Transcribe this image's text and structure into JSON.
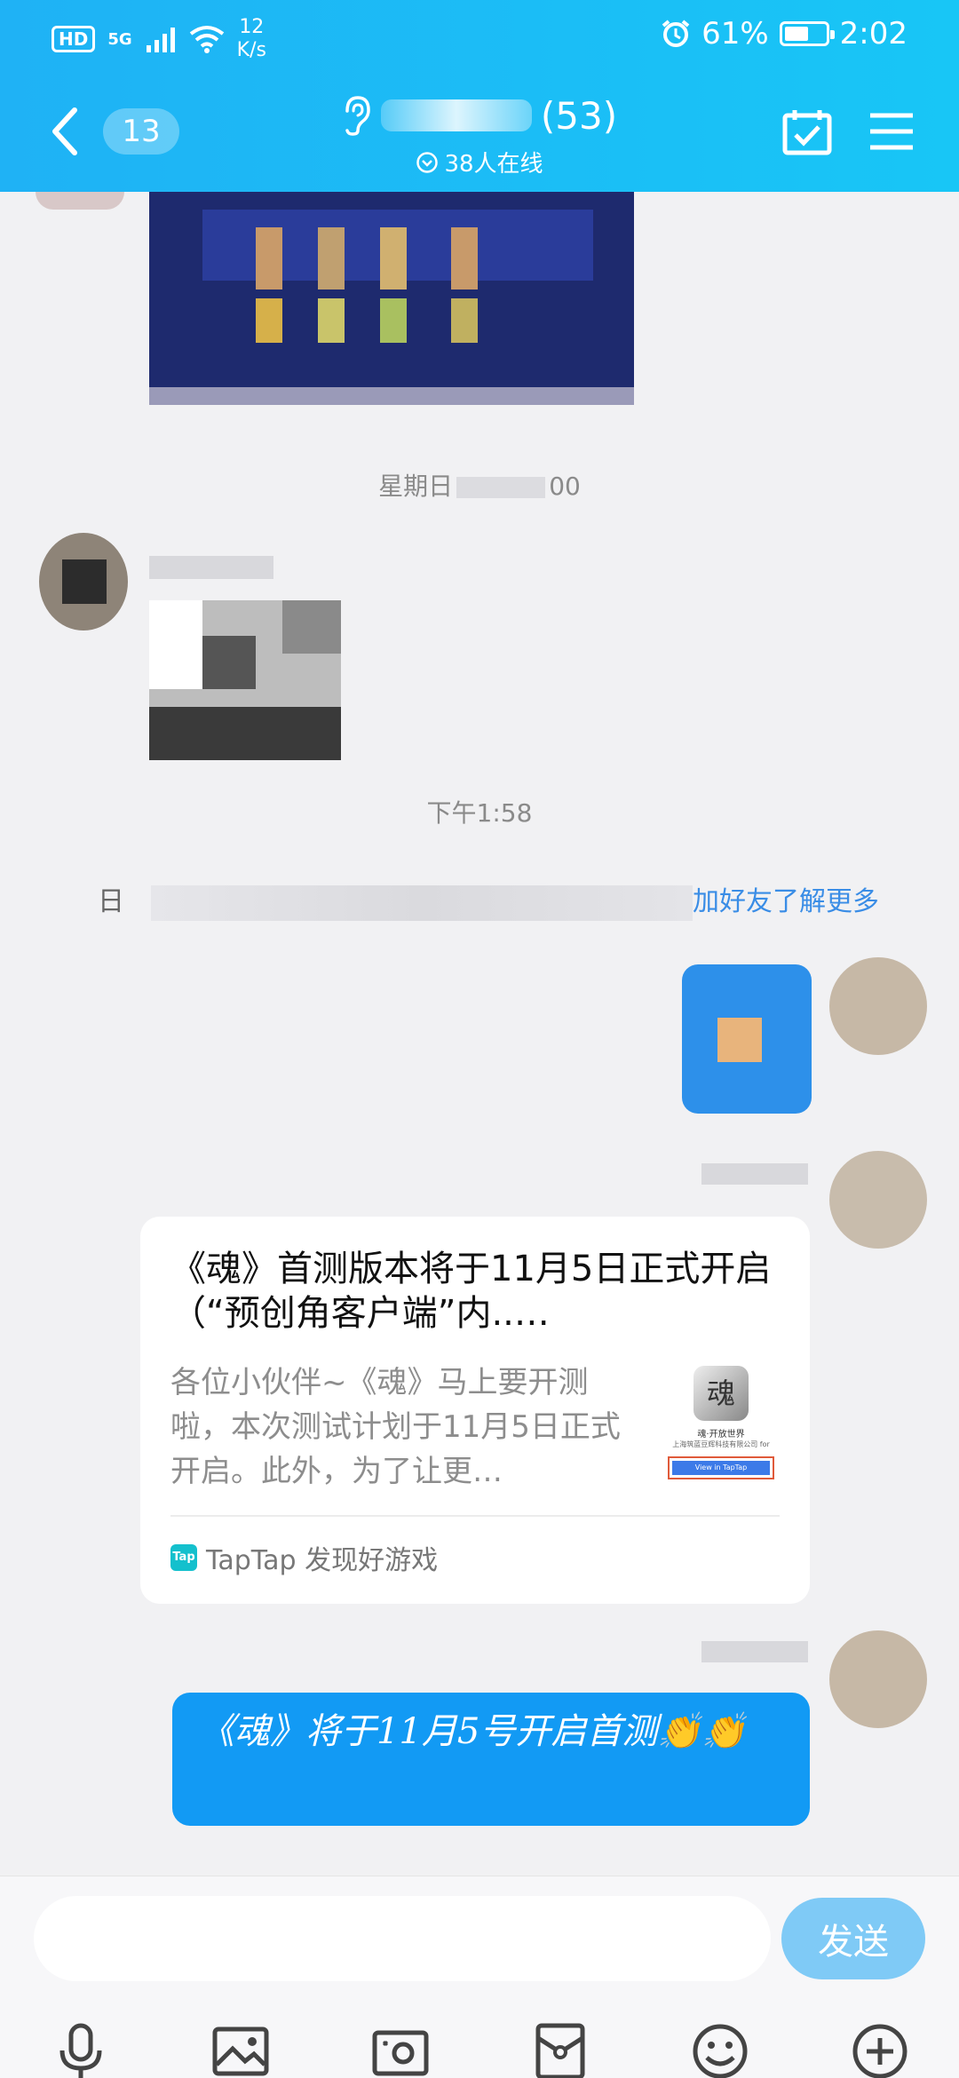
{
  "status_bar": {
    "hd": "HD",
    "network": "5G",
    "speed_value": "12",
    "speed_unit": "K/s",
    "battery": "61%",
    "battery_level": 0.61,
    "time": "2:02"
  },
  "header": {
    "unread_count": "13",
    "group_count": "(53)",
    "online": "38人在线"
  },
  "chat": {
    "time_1": "星期日",
    "time_1_tail": "00",
    "time_2": "下午1:58",
    "system_message": {
      "prefix": "日",
      "link": "加好友了解更多"
    },
    "link_card": {
      "title": "《魂》首测版本将于11月5日正式开启（“预创角客户端”内..…",
      "description": "各位小伙伴~《魂》马上要开测啦，本次测试计划于11月5日正式开启。此外，为了让更…",
      "thumb_name": "魂·开放世界",
      "thumb_company": "上海筑蓝豆辉科技有限公司 for",
      "thumb_button": "View in TapTap",
      "source_logo": "Tap",
      "source": "TapTap 发现好游戏"
    },
    "bubble_text": "《魂》将于11月5号开启首测👏👏"
  },
  "input": {
    "placeholder": "",
    "send_label": "发送"
  },
  "colors": {
    "header": "#1fb2f5",
    "bubble": "#129af4",
    "link": "#3a8de6",
    "send": "#7fcaf6"
  },
  "toolbar_icons": [
    "mic-icon",
    "image-icon",
    "camera-icon",
    "red-packet-icon",
    "emoji-icon",
    "plus-icon"
  ]
}
